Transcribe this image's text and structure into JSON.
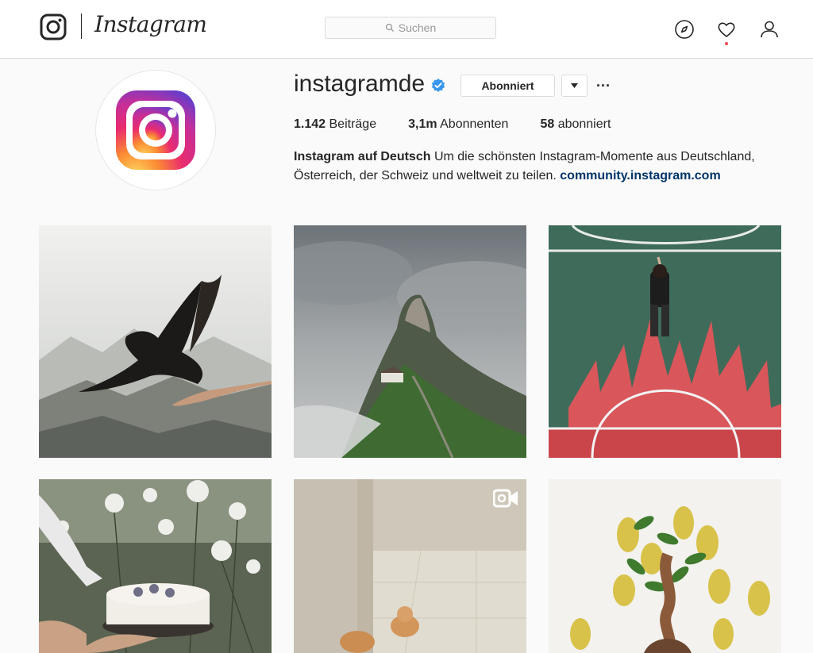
{
  "nav": {
    "wordmark": "Instagram",
    "search_placeholder": "Suchen",
    "icons": [
      "instagram-glyph-icon",
      "search-icon",
      "compass-icon",
      "heart-icon",
      "person-icon"
    ]
  },
  "profile": {
    "username": "instagramde",
    "verified": true,
    "follow_button_label": "Abonniert",
    "more_label": "···",
    "stats": [
      {
        "value": "1.142",
        "label": "Beiträge"
      },
      {
        "value": "3,1m",
        "label": "Abonnenten"
      },
      {
        "value": "58",
        "label": "abonniert"
      }
    ],
    "bio_name": "Instagram auf Deutsch",
    "bio_text": "Um die schönsten Instagram-Momente aus Deutschland, Österreich, der Schweiz und weltweit zu teilen.",
    "bio_link": "community.instagram.com"
  },
  "posts": [
    {
      "subject": "bird-hand",
      "is_video": false
    },
    {
      "subject": "mountain-peak",
      "is_video": false
    },
    {
      "subject": "court-flames",
      "is_video": false
    },
    {
      "subject": "cake-flowers",
      "is_video": false
    },
    {
      "subject": "kitten-mirror",
      "is_video": true
    },
    {
      "subject": "pears-braid",
      "is_video": false
    }
  ],
  "colors": {
    "accent_link": "#003569",
    "verified_blue": "#3897f0",
    "notification_dot": "#ed4956",
    "border": "#dbdbdb"
  }
}
